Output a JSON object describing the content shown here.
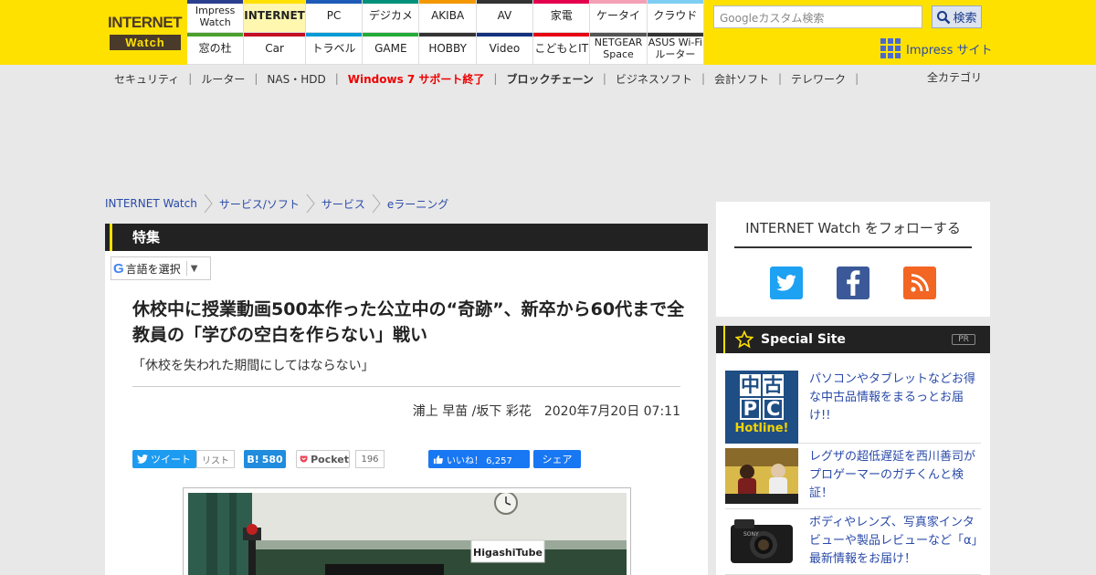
{
  "logo": {
    "line1": "INTERNET",
    "line2": "Watch"
  },
  "nav": [
    {
      "label": "Impress Watch",
      "color": "#2b3f8f",
      "active": false
    },
    {
      "label": "INTERNET",
      "color": "#ffe100",
      "active": true
    },
    {
      "label": "PC",
      "color": "#1e5bb8",
      "active": false
    },
    {
      "label": "デジカメ",
      "color": "#00917a",
      "active": false
    },
    {
      "label": "AKIBA",
      "color": "#f39800",
      "active": false
    },
    {
      "label": "AV",
      "color": "#333333",
      "active": false
    },
    {
      "label": "家電",
      "color": "#e5004f",
      "active": false
    },
    {
      "label": "ケータイ",
      "color": "#f4a0b4",
      "active": false
    },
    {
      "label": "クラウド",
      "color": "#7ecef4",
      "active": false
    },
    {
      "label": "窓の杜",
      "color": "#4aa02c",
      "active": false
    },
    {
      "label": "Car",
      "color": "#c30d23",
      "active": false
    },
    {
      "label": "トラベル",
      "color": "#009ad6",
      "active": false
    },
    {
      "label": "GAME",
      "color": "#23ac38",
      "active": false
    },
    {
      "label": "HOBBY",
      "color": "#333333",
      "active": false
    },
    {
      "label": "Video",
      "color": "#13317d",
      "active": false
    },
    {
      "label": "こどもとIT",
      "color": "#e60012",
      "active": false
    },
    {
      "label": "NETGEAR Space",
      "color": "#555555",
      "active": false
    },
    {
      "label": "ASUS Wi-Fiルーター",
      "color": "#333333",
      "active": false
    }
  ],
  "search": {
    "placeholder": "Googleカスタム検索",
    "button": "検索"
  },
  "impress_site": "Impress サイト",
  "categories": [
    {
      "label": "セキュリティ",
      "style": "normal"
    },
    {
      "label": "ルーター",
      "style": "normal"
    },
    {
      "label": "NAS・HDD",
      "style": "normal"
    },
    {
      "label": "Windows 7 サポート終了",
      "style": "red"
    },
    {
      "label": "ブロックチェーン",
      "style": "bold"
    },
    {
      "label": "ビジネスソフト",
      "style": "normal"
    },
    {
      "label": "会計ソフト",
      "style": "normal"
    },
    {
      "label": "テレワーク",
      "style": "normal"
    }
  ],
  "all_categories": "全カテゴリ",
  "breadcrumb": [
    "INTERNET Watch",
    "サービス/ソフト",
    "サービス",
    "eラーニング"
  ],
  "section": "特集",
  "translate": {
    "label": "言語を選択"
  },
  "article": {
    "title": "休校中に授業動画500本作った公立中の“奇跡”、新卒から60代まで全教員の「学びの空白を作らない」戦い",
    "subtitle": "「休校を失われた期間にしてはならない」",
    "byline": "浦上 早苗 /坂下 彩花　2020年7月20日 07:11",
    "photo_caption_sign": "HigashiTube"
  },
  "share": {
    "tweet": "ツイート",
    "list": "リスト",
    "hatena_count": "580",
    "pocket": "Pocket",
    "pocket_count": "196",
    "fb_like": "いいね！ 6,257",
    "fb_share": "シェア"
  },
  "follow": {
    "title": "INTERNET Watch をフォローする"
  },
  "special": {
    "title": "Special Site",
    "pr": "PR",
    "items": [
      {
        "text": "パソコンやタブレットなどお得な中古品情報をまるっとお届け!!",
        "thumb": "中古PC Hotline!"
      },
      {
        "text": "レグザの超低遅延を西川善司がプロゲーマーのガチくんと検証！"
      },
      {
        "text": "ボディやレンズ、写真家インタビューや製品レビューなど「α」最新情報をお届け！"
      }
    ]
  }
}
